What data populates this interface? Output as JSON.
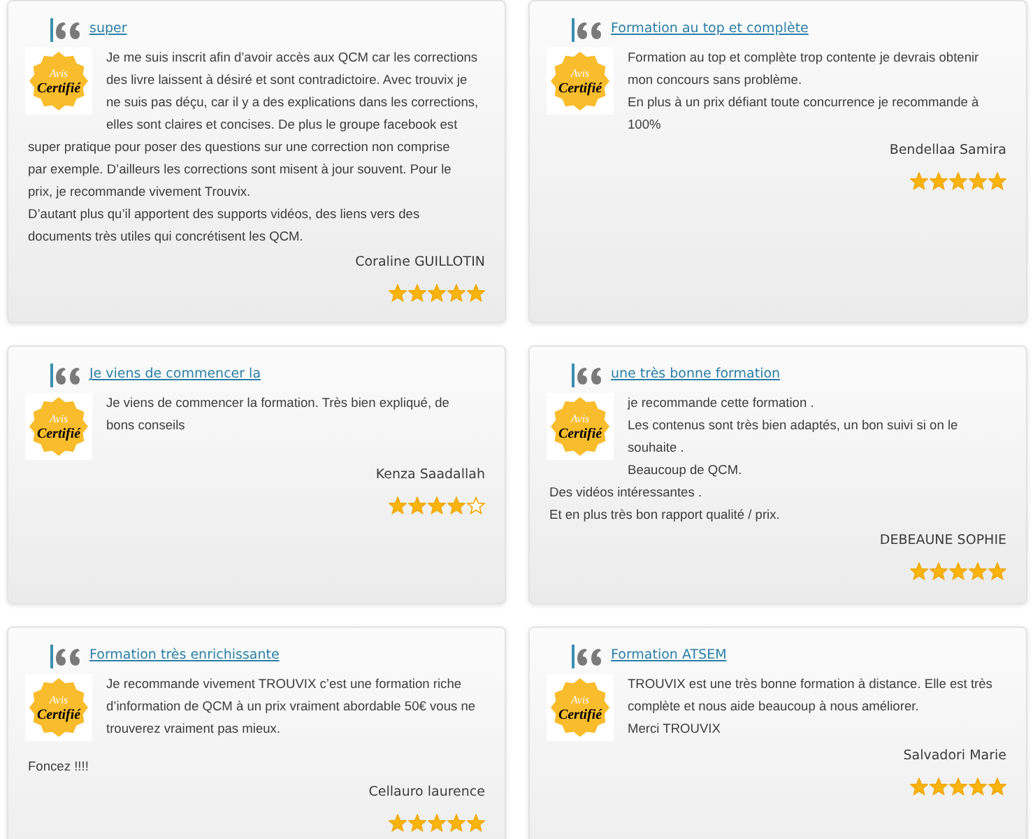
{
  "reviews": [
    {
      "title": "super",
      "badge": {
        "top": "Avis",
        "bottom": "Certifié"
      },
      "lines_beside_badge": [
        "Je me suis inscrit afin d’avoir accès aux QCM car les corrections",
        "des livre laissent à désiré et sont contradictoire. Avec trouvix je",
        "ne suis pas déçu, car il y a des explications dans les corrections,",
        "elles sont claires et concises. De plus le groupe facebook est"
      ],
      "lines_below_badge": [
        "super pratique pour poser des questions sur une correction non comprise",
        "par exemple. D’ailleurs les corrections sont misent à jour souvent. Pour le",
        "prix, je recommande vivement Trouvix.",
        "D’autant plus qu’il apportent des supports vidéos, des liens vers des",
        "documents très utiles qui concrétisent les QCM."
      ],
      "author": "Coraline GUILLOTIN",
      "stars": 5
    },
    {
      "title": "Formation au top et complète",
      "badge": {
        "top": "Avis",
        "bottom": "Certifié"
      },
      "lines_beside_badge": [
        "Formation au top et complète trop contente je devrais obtenir",
        "mon concours sans problème.",
        "En plus à un prix défiant toute concurrence je recommande à",
        "100%"
      ],
      "author": "Bendellaa Samira",
      "stars": 5
    },
    {
      "title": "Je viens de commencer la",
      "badge": {
        "top": "Avis",
        "bottom": "Certifié"
      },
      "lines_beside_badge": [
        "Je viens de commencer la formation. Très bien expliqué, de",
        "bons conseils"
      ],
      "author": "Kenza Saadallah",
      "stars": 4
    },
    {
      "title": "une très bonne formation",
      "badge": {
        "top": "Avis",
        "bottom": "Certifié"
      },
      "lines_beside_badge": [
        "je recommande cette formation .",
        "Les contenus sont très bien adaptés, un bon suivi si on le",
        "souhaite .",
        "Beaucoup de QCM."
      ],
      "lines_below_badge": [
        "Des vidéos intéressantes .",
        "Et en plus très bon rapport qualité / prix."
      ],
      "author": "DEBEAUNE SOPHIE",
      "stars": 5
    },
    {
      "title": "Formation très enrichissante",
      "badge": {
        "top": "Avis",
        "bottom": "Certifié"
      },
      "lines_beside_badge": [
        "Je recommande vivement TROUVIX c’est une formation riche",
        "d’information de QCM à un prix vraiment abordable 50€ vous ne",
        "trouverez vraiment pas mieux."
      ],
      "lines_below_badge": [
        "Foncez !!!!"
      ],
      "author": "Cellauro laurence",
      "stars": 5
    },
    {
      "title": "Formation ATSEM",
      "badge": {
        "top": "Avis",
        "bottom": "Certifié"
      },
      "lines_beside_badge": [
        "TROUVIX est une très bonne formation à distance. Elle est très",
        "complète et nous aide beaucoup à nous améliorer.",
        "Merci TROUVIX"
      ],
      "author": "Salvadori Marie",
      "stars": 5
    }
  ]
}
